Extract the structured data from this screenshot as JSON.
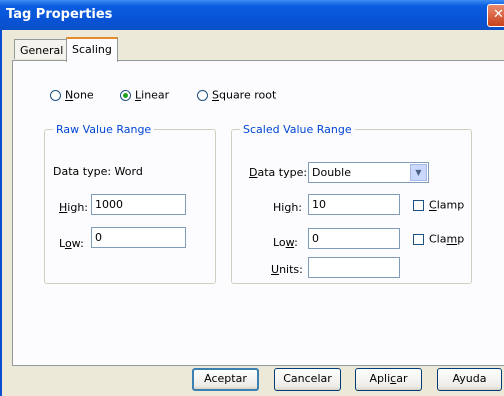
{
  "window": {
    "title": "Tag Properties",
    "close_glyph": "✕"
  },
  "tabs": [
    {
      "label": "General",
      "active": false
    },
    {
      "label": "Scaling",
      "active": true
    }
  ],
  "scaling_mode": {
    "options": [
      {
        "label": "None",
        "selected": false
      },
      {
        "label": "Linear",
        "selected": true
      },
      {
        "label": "Square root",
        "selected": false
      }
    ]
  },
  "raw_range": {
    "title": "Raw Value Range",
    "data_type_text": "Data type: Word",
    "high_label": "High:",
    "high_value": "1000",
    "low_label": "Low:",
    "low_value": "0"
  },
  "scaled_range": {
    "title": "Scaled Value Range",
    "data_type_label": "Data type:",
    "data_type_value": "Double",
    "high_label": "High:",
    "high_value": "10",
    "low_label": "Low:",
    "low_value": "0",
    "units_label": "Units:",
    "units_value": "",
    "clamp_high_label": "Clamp",
    "clamp_high_checked": false,
    "clamp_low_label": "Clamp",
    "clamp_low_checked": false
  },
  "buttons": {
    "ok": "Aceptar",
    "cancel": "Cancelar",
    "apply": "Aplicar",
    "help": "Ayuda"
  },
  "colors": {
    "titlebar": "#0a5ddf",
    "group_title": "#0046d5",
    "active_tab_accent": "#e68b2c"
  }
}
